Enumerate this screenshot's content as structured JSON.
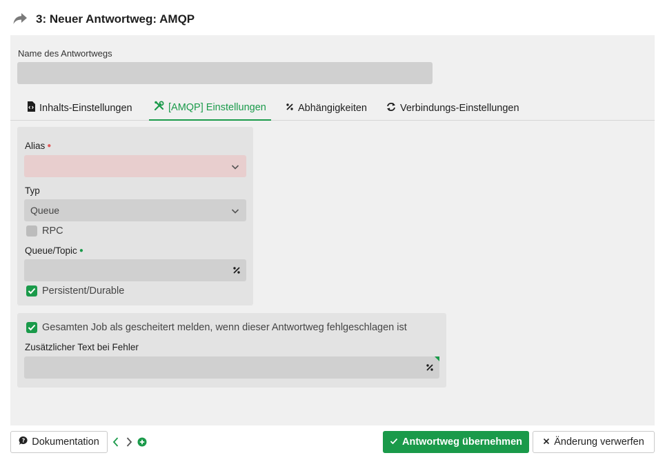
{
  "header": {
    "title": "3: Neuer Antwortweg: AMQP",
    "icon": "reply-arrow-icon"
  },
  "name_field": {
    "label": "Name des Antwortwegs",
    "value": ""
  },
  "tabs": [
    {
      "label": "Inhalts-Einstellungen",
      "icon": "file-code-icon",
      "active": false
    },
    {
      "label": "[AMQP] Einstellungen",
      "icon": "tools-icon",
      "active": true
    },
    {
      "label": "Abhängigkeiten",
      "icon": "percent-icon",
      "active": false
    },
    {
      "label": "Verbindungs-Einstellungen",
      "icon": "sync-icon",
      "active": false
    }
  ],
  "amqp": {
    "alias": {
      "label": "Alias",
      "value": "",
      "required": true
    },
    "typ": {
      "label": "Typ",
      "value": "Queue"
    },
    "rpc": {
      "label": "RPC",
      "checked": false
    },
    "queue_topic": {
      "label": "Queue/Topic",
      "value": ""
    },
    "persistent": {
      "label": "Persistent/Durable",
      "checked": true
    }
  },
  "error": {
    "fail_job": {
      "label": "Gesamten Job als gescheitert melden, wenn dieser Antwortweg fehlgeschlagen ist",
      "checked": true
    },
    "extra_text": {
      "label": "Zusätzlicher Text bei Fehler",
      "value": ""
    }
  },
  "footer": {
    "doc_button": "Dokumentation",
    "apply_button": "Antwortweg übernehmen",
    "discard_button": "Änderung verwerfen"
  },
  "colors": {
    "accent": "#1a9a4a",
    "error_field": "#e8cece",
    "field": "#d0d0d0"
  }
}
